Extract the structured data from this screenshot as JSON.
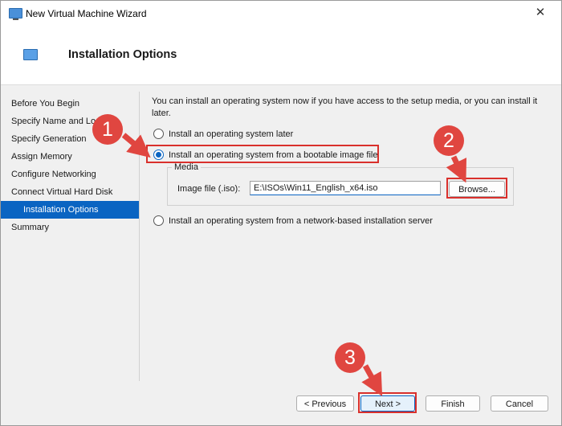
{
  "window": {
    "title": "New Virtual Machine Wizard",
    "close_glyph": "✕"
  },
  "header": {
    "title": "Installation Options"
  },
  "nav": {
    "items": [
      {
        "label": "Before You Begin"
      },
      {
        "label": "Specify Name and Lo"
      },
      {
        "label": "Specify Generation"
      },
      {
        "label": "Assign Memory"
      },
      {
        "label": "Configure Networking"
      },
      {
        "label": "Connect Virtual Hard Disk"
      },
      {
        "label": "Installation Options",
        "active": true
      },
      {
        "label": "Summary"
      }
    ]
  },
  "content": {
    "intro": "You can install an operating system now if you have access to the setup media, or you can install it later.",
    "options": {
      "later": "Install an operating system later",
      "image": "Install an operating system from a bootable image file",
      "network": "Install an operating system from a network-based installation server"
    },
    "selected_option": "image",
    "media": {
      "group_label": "Media",
      "image_file_label": "Image file (.iso):",
      "image_file_value": "E:\\ISOs\\Win11_English_x64.iso",
      "browse_label": "Browse..."
    }
  },
  "footer": {
    "previous_label": "< Previous",
    "next_label": "Next >",
    "finish_label": "Finish",
    "cancel_label": "Cancel"
  },
  "annotations": {
    "step1": "1",
    "step2": "2",
    "step3": "3",
    "color": "#e04640"
  }
}
